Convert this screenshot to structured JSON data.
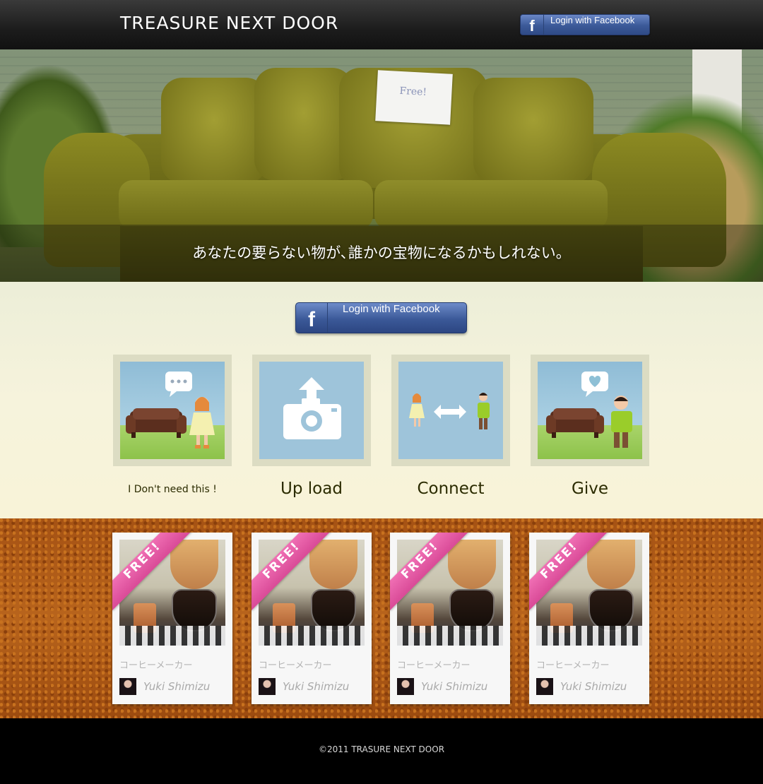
{
  "header": {
    "brand": "TREASURE NEXT DOOR",
    "login_label": "Login with Facebook",
    "facebook_glyph": "f"
  },
  "hero": {
    "tagline": "あなたの要らない物が､誰かの宝物になるかもしれない。",
    "note_text": "Free!"
  },
  "main": {
    "login_label": "Login with Facebook",
    "facebook_glyph": "f",
    "steps": [
      {
        "label": "I Don't need this !",
        "icon": "sofa-girl-icon"
      },
      {
        "label": "Up load",
        "icon": "camera-upload-icon"
      },
      {
        "label": "Connect",
        "icon": "connect-people-icon"
      },
      {
        "label": "Give",
        "icon": "give-heart-icon"
      }
    ]
  },
  "items": [
    {
      "badge": "FREE!",
      "title": "コーヒーメーカー",
      "user": "Yuki Shimizu"
    },
    {
      "badge": "FREE!",
      "title": "コーヒーメーカー",
      "user": "Yuki Shimizu"
    },
    {
      "badge": "FREE!",
      "title": "コーヒーメーカー",
      "user": "Yuki Shimizu"
    },
    {
      "badge": "FREE!",
      "title": "コーヒーメーカー",
      "user": "Yuki Shimizu"
    }
  ],
  "footer": {
    "copyright": "©2011 TRASURE NEXT DOOR"
  },
  "colors": {
    "facebook_blue": "#3b5998",
    "ribbon_pink": "#e35aa5",
    "cork_brown": "#a55214"
  }
}
